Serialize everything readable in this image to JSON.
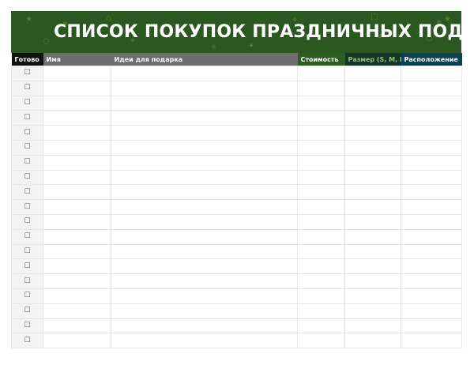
{
  "title": "СПИСОК ПОКУПОК ПРАЗДНИЧНЫХ ПОДАРКОВ",
  "columns": {
    "done": "Готово",
    "name": "Имя",
    "ideas": "Идеи для подарка",
    "cost": "Стоимость",
    "size": "Размер (S, M, L)",
    "location": "Расположение"
  },
  "checkbox_glyph": "☐",
  "row_count": 19,
  "colors": {
    "banner": "#2b5720",
    "header_done": "#111111",
    "header_gray": "#6e6e6e",
    "header_cost": "#2d5d22",
    "header_size": "#16362a",
    "header_location": "#0d4050"
  }
}
